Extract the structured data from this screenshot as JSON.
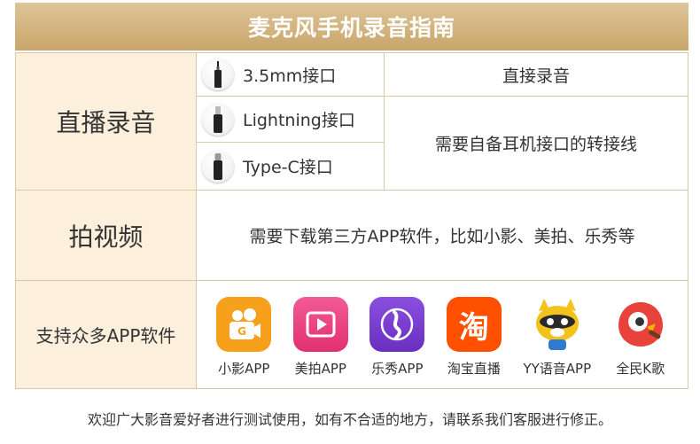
{
  "title": "麦克风手机录音指南",
  "sections": {
    "live": {
      "label": "直播录音",
      "connectors": [
        {
          "name": "3.5mm接口",
          "icon": "jack-3-5mm-icon"
        },
        {
          "name": "Lightning接口",
          "icon": "lightning-plug-icon"
        },
        {
          "name": "Type-C接口",
          "icon": "type-c-plug-icon"
        }
      ],
      "direct": "直接录音",
      "adapter": "需要自备耳机接口的转接线"
    },
    "video": {
      "label": "拍视频",
      "note": "需要下载第三方APP软件，比如小影、美拍、乐秀等"
    },
    "apps": {
      "label": "支持众多APP软件",
      "items": [
        {
          "name": "小影APP",
          "icon": "xiaoying-icon",
          "color": "#f7a01c"
        },
        {
          "name": "美拍APP",
          "icon": "meipai-icon",
          "color": "#ee3d7e"
        },
        {
          "name": "乐秀APP",
          "icon": "lexiu-icon",
          "color": "#7a3fd0"
        },
        {
          "name": "淘宝直播",
          "icon": "taobao-live-icon",
          "color": "#ff5000",
          "glyph": "淘"
        },
        {
          "name": "YY语音APP",
          "icon": "yy-raccoon-icon",
          "color": "#f3c21b"
        },
        {
          "name": "全民K歌",
          "icon": "quanmin-kge-icon",
          "color": "#e8423a"
        }
      ]
    }
  },
  "footer": "欢迎广大影音爱好者进行测试使用，如有不合适的地方，请联系我们客服进行修正。"
}
